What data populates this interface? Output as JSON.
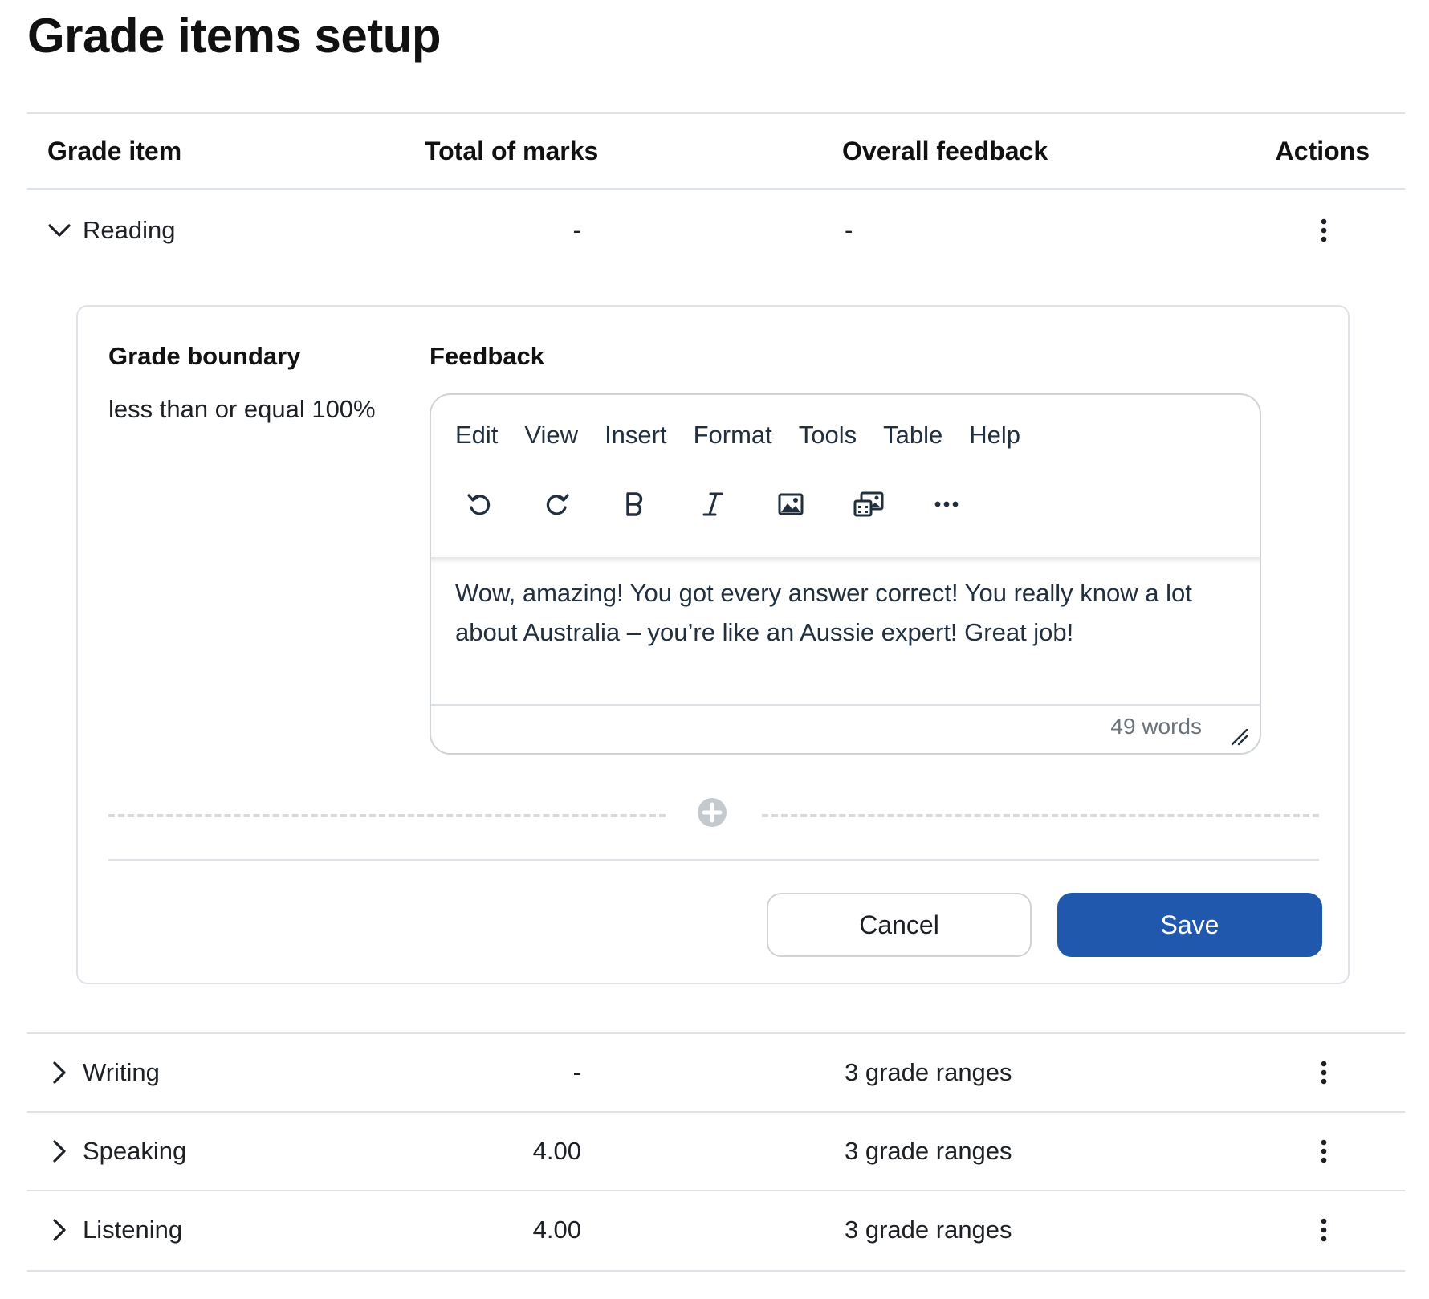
{
  "page": {
    "title": "Grade items setup"
  },
  "table": {
    "headers": {
      "grade_item": "Grade item",
      "total_of_marks": "Total of marks",
      "overall_feedback": "Overall feedback",
      "actions": "Actions"
    },
    "rows": [
      {
        "name": "Reading",
        "total": "-",
        "feedback": "-",
        "expanded": true
      },
      {
        "name": "Writing",
        "total": "-",
        "feedback": "3 grade ranges",
        "expanded": false
      },
      {
        "name": "Speaking",
        "total": "4.00",
        "feedback": "3 grade ranges",
        "expanded": false
      },
      {
        "name": "Listening",
        "total": "4.00",
        "feedback": "3 grade ranges",
        "expanded": false
      }
    ]
  },
  "panel": {
    "grade_boundary_label": "Grade boundary",
    "grade_boundary_value": "less than or equal 100%",
    "feedback_label": "Feedback",
    "editor": {
      "menu": [
        "Edit",
        "View",
        "Insert",
        "Format",
        "Tools",
        "Table",
        "Help"
      ],
      "toolbar": [
        "undo-icon",
        "redo-icon",
        "bold-icon",
        "italic-icon",
        "image-icon",
        "media-icon",
        "more-icon"
      ],
      "content": "Wow, amazing! You got every answer correct! You really know a lot about Australia – you’re like an Aussie expert! Great job!",
      "word_count": "49 words"
    },
    "buttons": {
      "cancel": "Cancel",
      "save": "Save"
    }
  },
  "colors": {
    "primary": "#2058ad",
    "border": "#dee2e6",
    "text": "#1d2125",
    "muted": "#6a737b"
  }
}
